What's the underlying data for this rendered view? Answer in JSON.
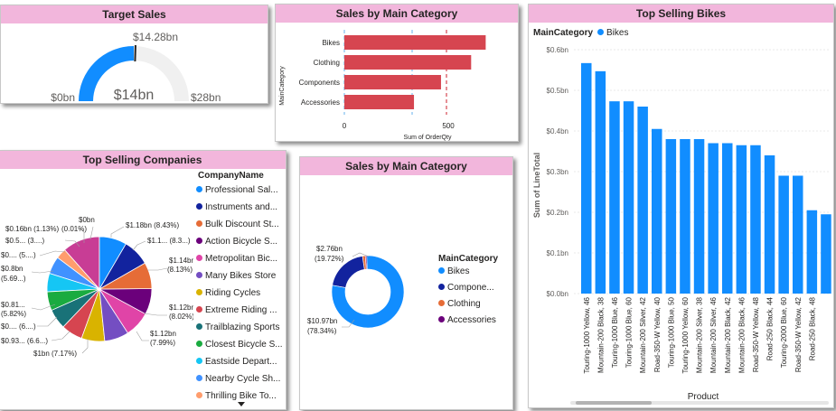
{
  "target_sales": {
    "title": "Target Sales",
    "value_label": "$14bn",
    "min_label": "$0bn",
    "max_label": "$28bn",
    "target_label": "$14.28bn",
    "value": 14,
    "max": 28,
    "target": 14.28,
    "fill_color": "#118dff",
    "track_color": "#f0f0f0"
  },
  "bar_panel": {
    "title": "Sales by Main Category",
    "x_axis_title": "Sum of OrderQty",
    "y_axis_title": "MainCategory",
    "x_ticks": [
      "0",
      "500"
    ]
  },
  "companies_panel": {
    "title": "Top Selling Companies",
    "legend_title": "CompanyName",
    "legend": [
      {
        "label": "Professional Sal...",
        "color": "#118dff"
      },
      {
        "label": "Instruments and...",
        "color": "#12239e"
      },
      {
        "label": "Bulk Discount St...",
        "color": "#e66c37"
      },
      {
        "label": "Action Bicycle S...",
        "color": "#6b007b"
      },
      {
        "label": "Metropolitan Bic...",
        "color": "#e044a7"
      },
      {
        "label": "Many Bikes Store",
        "color": "#744ec2"
      },
      {
        "label": "Riding Cycles",
        "color": "#d9b300"
      },
      {
        "label": "Extreme Riding ...",
        "color": "#d64550"
      },
      {
        "label": "Trailblazing Sports",
        "color": "#197278"
      },
      {
        "label": "Closest Bicycle S...",
        "color": "#1aab40"
      },
      {
        "label": "Eastside Depart...",
        "color": "#15c6f4"
      },
      {
        "label": "Nearby Cycle Sh...",
        "color": "#4092ff"
      },
      {
        "label": "Thrilling Bike To...",
        "color": "#ff9d6d"
      }
    ],
    "labels": {
      "l0": "$0bn",
      "l1": "$0.16bn (1.13%)",
      "l1b": "(0.01%)",
      "l2": "$1.18bn (8.43%)",
      "l3": "$0.5... (3....)",
      "l4": "$1.1... (8.3...)",
      "l5": "$0.... (5....)",
      "l6": "$1.14bn",
      "l6b": "(8.13%)",
      "l7": "$0.8bn",
      "l7b": "(5.69...)",
      "l8": "$0.81...",
      "l8b": "(5.82%)",
      "l9": "$1.12bn",
      "l9b": "(8.02%)",
      "l10": "$0.... (6....)",
      "l11": "$1.12bn",
      "l11b": "(7.99%)",
      "l12": "$0.93... (6.6...)",
      "l13": "$1bn (7.17%)"
    }
  },
  "donut_panel": {
    "title": "Sales by Main Category",
    "legend_title": "MainCategory",
    "legend": [
      {
        "label": "Bikes",
        "color": "#118dff"
      },
      {
        "label": "Compone...",
        "color": "#12239e"
      },
      {
        "label": "Clothing",
        "color": "#e66c37"
      },
      {
        "label": "Accessories",
        "color": "#6b007b"
      }
    ],
    "label_top": "$2.76bn",
    "label_top_pct": "(19.72%)",
    "label_bottom": "$10.97bn",
    "label_bottom_pct": "(78.34%)"
  },
  "bikes_panel": {
    "title": "Top Selling Bikes",
    "legend_title": "MainCategory",
    "legend_item": "Bikes",
    "x_axis_title": "Product",
    "y_axis_title": "Sum of LineTotal",
    "y_ticks": [
      "$0.0bn",
      "$0.1bn",
      "$0.2bn",
      "$0.3bn",
      "$0.4bn",
      "$0.5bn",
      "$0.6bn"
    ]
  },
  "chart_data": [
    {
      "type": "bar",
      "title": "Sales by Main Category",
      "orientation": "horizontal",
      "xlabel": "Sum of OrderQty",
      "ylabel": "MainCategory",
      "categories": [
        "Bikes",
        "Clothing",
        "Components",
        "Accessories"
      ],
      "values": [
        680,
        610,
        465,
        335
      ],
      "xlim": [
        0,
        750
      ],
      "color": "#d64550"
    },
    {
      "type": "pie",
      "title": "Top Selling Companies",
      "categories": [
        "Professional Sal...",
        "Instruments and...",
        "Bulk Discount St...",
        "Action Bicycle S...",
        "Metropolitan Bic...",
        "Many Bikes Store",
        "Riding Cycles",
        "Extreme Riding ...",
        "Trailblazing Sports",
        "Closest Bicycle S...",
        "Eastside Depart...",
        "Nearby Cycle Sh...",
        "Thrilling Bike To...",
        "Others"
      ],
      "values": [
        8.43,
        8.3,
        8.13,
        8.02,
        7.99,
        7.5,
        7.17,
        6.6,
        6.2,
        5.82,
        5.69,
        5.4,
        3.2,
        11.55
      ],
      "colors": [
        "#118dff",
        "#12239e",
        "#e66c37",
        "#6b007b",
        "#e044a7",
        "#744ec2",
        "#d9b300",
        "#d64550",
        "#197278",
        "#1aab40",
        "#15c6f4",
        "#4092ff",
        "#ff9d6d",
        "#c83d95"
      ]
    },
    {
      "type": "pie",
      "title": "Sales by Main Category",
      "categories": [
        "Bikes",
        "Components",
        "Clothing",
        "Accessories"
      ],
      "values": [
        78.34,
        19.72,
        1.3,
        0.64
      ],
      "colors": [
        "#118dff",
        "#12239e",
        "#e66c37",
        "#6b007b"
      ]
    },
    {
      "type": "bar",
      "title": "Top Selling Bikes",
      "xlabel": "Product",
      "ylabel": "Sum of LineTotal",
      "ylim": [
        0,
        0.6
      ],
      "series": [
        {
          "name": "Bikes",
          "color": "#118dff",
          "values": [
            0.567,
            0.547,
            0.473,
            0.473,
            0.46,
            0.405,
            0.38,
            0.38,
            0.38,
            0.37,
            0.37,
            0.365,
            0.365,
            0.34,
            0.29,
            0.29,
            0.205,
            0.195
          ]
        }
      ],
      "categories": [
        "Touring-1000 Yellow, 46",
        "Mountain-200 Black, 38",
        "Touring-1000 Blue, 46",
        "Touring-1000 Blue, 60",
        "Mountain-200 Silver, 42",
        "Road-350-W Yellow, 40",
        "Touring-1000 Blue, 50",
        "Touring-1000 Yellow, 60",
        "Mountain-200 Silver, 38",
        "Mountain-200 Silver, 46",
        "Mountain-200 Black, 42",
        "Mountain-200 Black, 46",
        "Road-350-W Yellow, 48",
        "Road-250 Black, 44",
        "Touring-2000 Blue, 60",
        "Road-350-W Yellow, 42",
        "Road-250 Black, 48"
      ]
    }
  ]
}
